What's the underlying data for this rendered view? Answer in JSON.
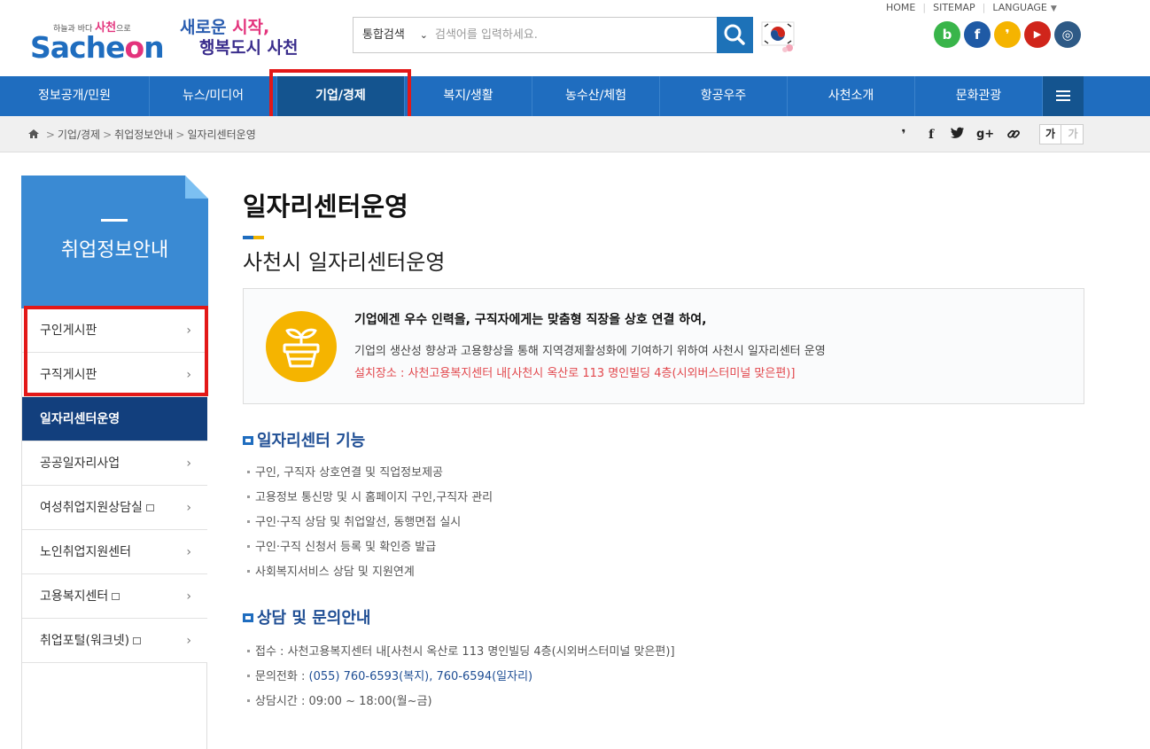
{
  "header": {
    "logo_tagline_pre": "하늘과 바다",
    "logo_tagline_mid": "사천",
    "logo_tagline_post": "으로",
    "logo_word_pre": "Sache",
    "logo_word_o": "o",
    "logo_word_post": "n",
    "slogan_line1_a": "새로운 ",
    "slogan_line1_b": "시작,",
    "slogan_line2": "행복도시 사천",
    "search": {
      "scope": "통합검색",
      "placeholder": "검색어를 입력하세요."
    },
    "top_links": {
      "home": "HOME",
      "sitemap": "SITEMAP",
      "language": "LANGUAGE"
    },
    "social": [
      {
        "icon": "blog-icon",
        "glyph": "b",
        "color": "#39b54a"
      },
      {
        "icon": "facebook-icon",
        "glyph": "f",
        "color": "#1f5aa5"
      },
      {
        "icon": "kakao-story-icon",
        "glyph": "❜",
        "color": "#f5b400"
      },
      {
        "icon": "youtube-icon",
        "glyph": "▶",
        "color": "#d0251b"
      },
      {
        "icon": "instagram-icon",
        "glyph": "◎",
        "color": "#2e5a86"
      }
    ]
  },
  "gnb": {
    "items": [
      "정보공개/민원",
      "뉴스/미디어",
      "기업/경제",
      "복지/생활",
      "농수산/체험",
      "항공우주",
      "사천소개",
      "문화관광"
    ],
    "active_index": 2
  },
  "breadcrumb": [
    "기업/경제",
    "취업정보안내",
    "일자리센터운영"
  ],
  "font_size": {
    "increase": "가",
    "decrease": "가"
  },
  "sidebar": {
    "title": "취업정보안내",
    "items": [
      {
        "label": "구인게시판",
        "external": false,
        "active": false
      },
      {
        "label": "구직게시판",
        "external": false,
        "active": false
      },
      {
        "label": "일자리센터운영",
        "external": false,
        "active": true
      },
      {
        "label": "공공일자리사업",
        "external": false,
        "active": false
      },
      {
        "label": "여성취업지원상담실",
        "external": true,
        "active": false
      },
      {
        "label": "노인취업지원센터",
        "external": false,
        "active": false
      },
      {
        "label": "고용복지센터",
        "external": true,
        "active": false
      },
      {
        "label": "취업포털(워크넷)",
        "external": true,
        "active": false
      }
    ]
  },
  "content": {
    "page_title": "일자리센터운영",
    "sub_title": "사천시 일자리센터운영",
    "intro": {
      "lead": "기업에겐 우수 인력을, 구직자에게는 맞춤형 직장을 상호 연결 하여,",
      "desc": "기업의 생산성 향상과 고용향상을 통해 지역경제활성화에 기여하기 위하여 사천시 일자리센터 운영",
      "location": "설치장소 : 사천고용복지센터 내[사천시 옥산로 113 명인빌딩 4층(시외버스터미널 맞은편)]"
    },
    "functions": {
      "heading": "일자리센터 기능",
      "items": [
        "구인, 구직자 상호연결 및 직업정보제공",
        "고용정보 통신망 및 시 홈페이지 구인,구직자 관리",
        "구인·구직 상담 및 취업알선, 동행면접 실시",
        "구인·구직 신청서 등록 및 확인증 발급",
        "사회복지서비스 상담 및 지원연계"
      ]
    },
    "contact": {
      "heading": "상담 및 문의안내",
      "reception": "접수 : 사천고용복지센터 내[사천시 옥산로 113 명인빌딩 4층(시외버스터미널 맞은편)]",
      "phone_label": "문의전화 : ",
      "phone_value": "(055) 760-6593(복지), 760-6594(일자리)",
      "hours": "상담시간 : 09:00 ~ 18:00(월~금)"
    }
  }
}
